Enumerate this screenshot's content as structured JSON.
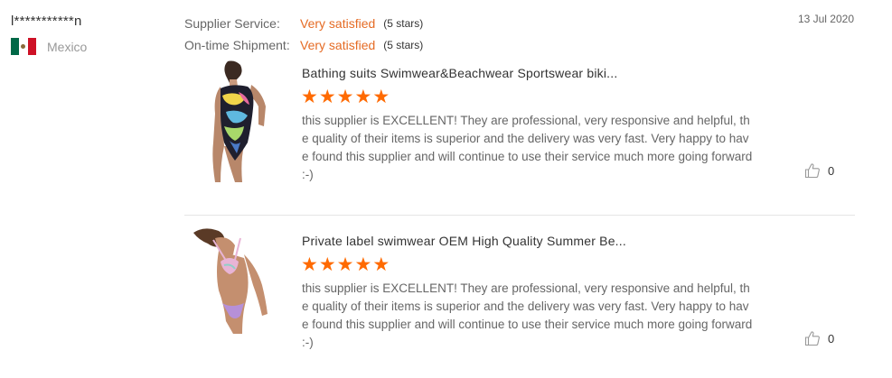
{
  "reviewer": {
    "name": "l***********n",
    "country": "Mexico",
    "flag_icon": "mexico-flag-icon"
  },
  "ratings": [
    {
      "label": "Supplier Service:",
      "value": "Very satisfied",
      "stars": "(5 stars)"
    },
    {
      "label": "On-time Shipment:",
      "value": "Very satisfied",
      "stars": "(5 stars)"
    }
  ],
  "date": "13 Jul 2020",
  "reviews": [
    {
      "product_title": "Bathing suits Swimwear&Beachwear Sportswear biki...",
      "rating": 5,
      "text": "this supplier is EXCELLENT! They are professional, very responsive and helpful, the quality of their items is superior and the delivery was very fast. Very happy to have found this supplier and will continue to use their service much more going forward :-)",
      "helpful_count": "0",
      "image": "one-piece-swimsuit-photo"
    },
    {
      "product_title": "Private label swimwear OEM High Quality Summer Be...",
      "rating": 5,
      "text": "this supplier is EXCELLENT! They are professional, very responsive and helpful, the quality of their items is superior and the delivery was very fast. Very happy to have found this supplier and will continue to use their service much more going forward :-)",
      "helpful_count": "0",
      "image": "bikini-swimsuit-photo"
    }
  ],
  "colors": {
    "accent": "#e56b24",
    "star": "#ff6a00",
    "muted": "#999999"
  }
}
